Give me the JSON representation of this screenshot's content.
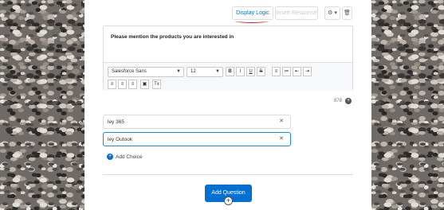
{
  "toolbar": {
    "display_logic_label": "Display Logic",
    "insert_response_label": "Insert Response",
    "gear_symbol": "⚙ ▾",
    "trash_symbol": "🗑"
  },
  "question": {
    "text": "Please mention the products you are interested in"
  },
  "editor": {
    "font_family_value": "Salesforce Sans",
    "font_size_value": "12",
    "format_buttons": [
      "B",
      "I",
      "U",
      "S"
    ],
    "list_buttons": [
      "≡",
      "≔",
      "⇤",
      "⇥"
    ],
    "align_buttons": [
      "≡",
      "≡",
      "≡",
      "▣",
      "Tx"
    ]
  },
  "char_count": "878",
  "choices": [
    {
      "value": "ley 365"
    },
    {
      "value": "ley Outook"
    }
  ],
  "add_choice_label": "Add Choice",
  "add_question_label": "Add Question",
  "colors": {
    "primary": "#0070d2",
    "annotation_red": "#e02020"
  }
}
